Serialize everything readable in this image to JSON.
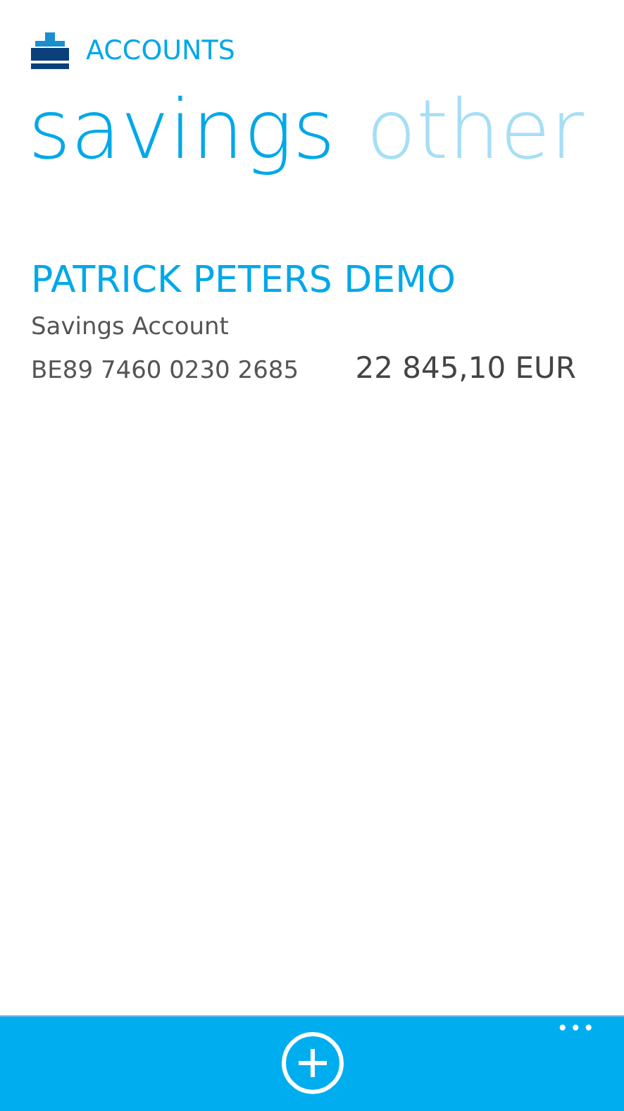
{
  "header": {
    "title": "ACCOUNTS"
  },
  "pivots": [
    {
      "label": "savings",
      "selected": true
    },
    {
      "label": "other",
      "selected": false
    }
  ],
  "accounts": [
    {
      "holder": "PATRICK PETERS DEMO",
      "type": "Savings Account",
      "iban": "BE89 7460 0230 2685",
      "balance": "22 845,10 EUR"
    }
  ],
  "app_bar": {
    "more": "•••"
  }
}
